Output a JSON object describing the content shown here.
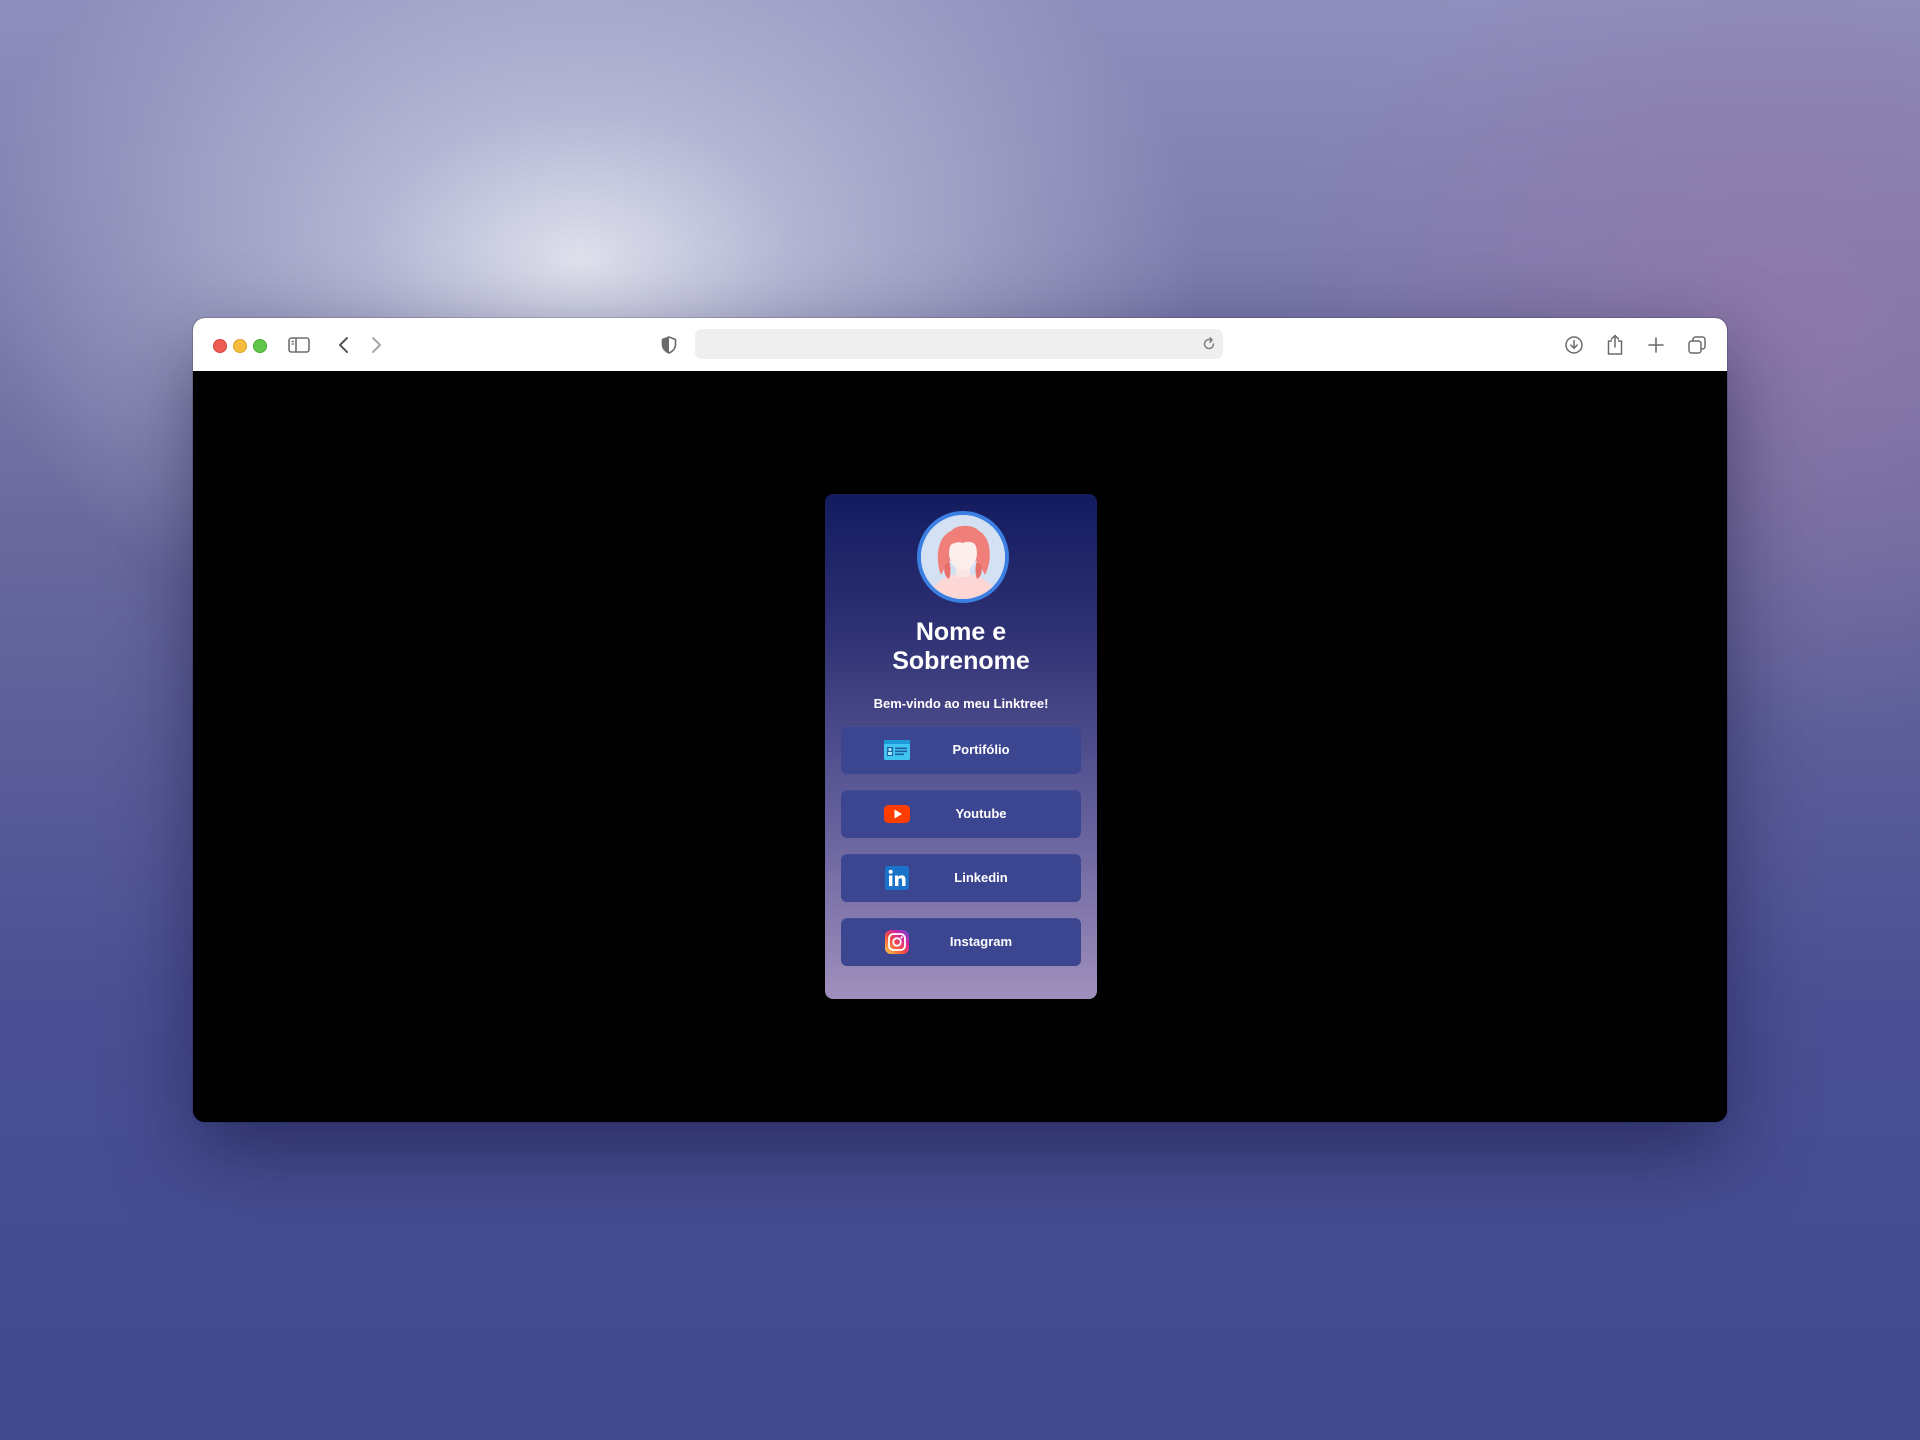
{
  "browser": {
    "url": "",
    "icons": {
      "sidebar": "sidebar-icon",
      "back": "chevron-left-icon",
      "forward": "chevron-right-icon",
      "shield": "shield-icon",
      "reload": "reload-icon",
      "download": "download-icon",
      "share": "share-icon",
      "new_tab": "plus-icon",
      "tabs": "tabs-overview-icon"
    }
  },
  "profile": {
    "name_line1": "Nome e",
    "name_line2": "Sobrenome",
    "subtitle": "Bem-vindo ao meu Linktree!",
    "avatar_icon": "woman-avatar-icon",
    "avatar_border_color": "#3b7fe3"
  },
  "links": [
    {
      "label": "Portifólio",
      "icon": "id-card-icon",
      "icon_color": "#3fc5f0"
    },
    {
      "label": "Youtube",
      "icon": "youtube-icon",
      "icon_color": "#ff3d00"
    },
    {
      "label": "Linkedin",
      "icon": "linkedin-icon",
      "icon_color": "#1b73c9"
    },
    {
      "label": "Instagram",
      "icon": "instagram-icon",
      "icon_color": "#e1306c"
    }
  ],
  "colors": {
    "page_background": "#000000",
    "card_gradient_top": "#131b5f",
    "card_gradient_bottom": "#9f8fbc",
    "button_background": "#3c458f",
    "text": "#ffffff"
  }
}
